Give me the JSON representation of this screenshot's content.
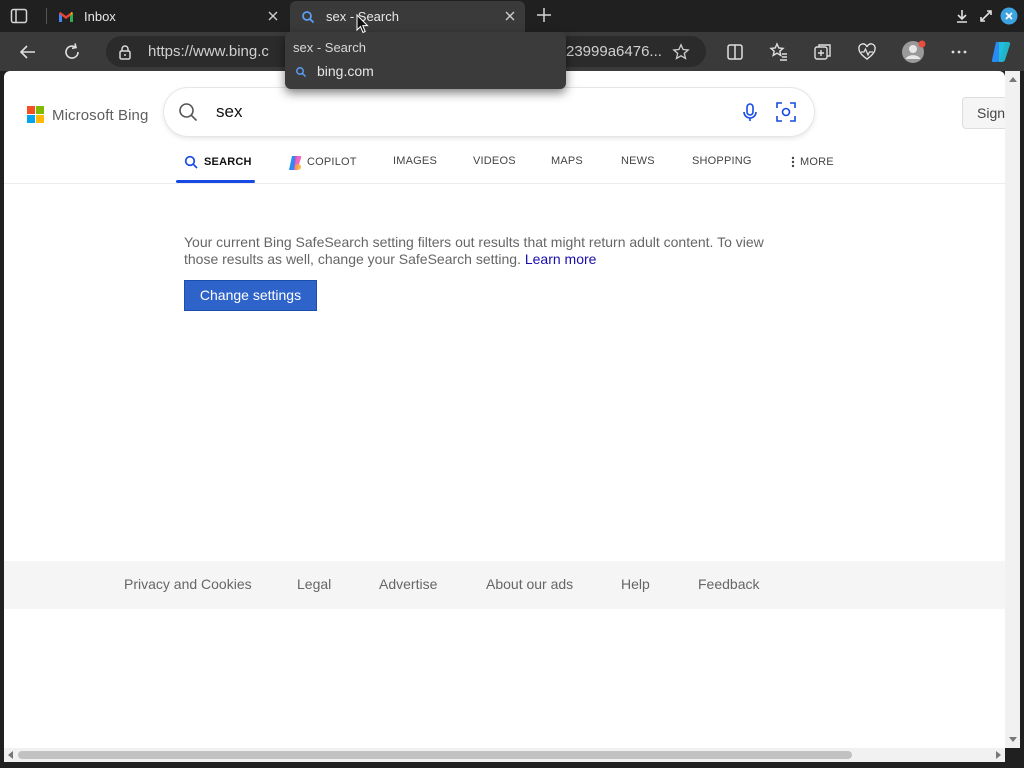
{
  "browser": {
    "tabs": [
      {
        "title": "Inbox",
        "favicon": "gmail-icon",
        "active": false
      },
      {
        "title": "sex - Search",
        "favicon": "bing-search-icon",
        "active": true
      }
    ],
    "address_bar": {
      "url_visible": "https://www.bing.c",
      "url_tail_visible": "23999a6476..."
    },
    "hover_card": {
      "title": "sex - Search",
      "domain": "bing.com"
    }
  },
  "bing": {
    "logo_text": "Microsoft Bing",
    "query": "sex",
    "sign_in_label": "Sign in",
    "scopes": [
      {
        "label": "SEARCH",
        "icon": "search-icon",
        "active": true
      },
      {
        "label": "COPILOT",
        "icon": "copilot-icon",
        "active": false
      },
      {
        "label": "IMAGES",
        "active": false
      },
      {
        "label": "VIDEOS",
        "active": false
      },
      {
        "label": "MAPS",
        "active": false
      },
      {
        "label": "NEWS",
        "active": false
      },
      {
        "label": "SHOPPING",
        "active": false
      },
      {
        "label": "MORE",
        "icon": "vertical-dots-icon",
        "active": false
      }
    ],
    "notice": {
      "text": "Your current Bing SafeSearch setting filters out results that might return adult content. To view those results as well, change your SafeSearch setting. ",
      "learn_more": "Learn more"
    },
    "change_settings_label": "Change settings",
    "footer_links": [
      "Privacy and Cookies",
      "Legal",
      "Advertise",
      "About our ads",
      "Help",
      "Feedback"
    ]
  },
  "colors": {
    "accent_blue": "#174ae4",
    "button_blue": "#2e63c9",
    "link_color": "#1a0dab",
    "chrome_dark": "#202020",
    "chrome_toolbar": "#3a3a3a"
  }
}
